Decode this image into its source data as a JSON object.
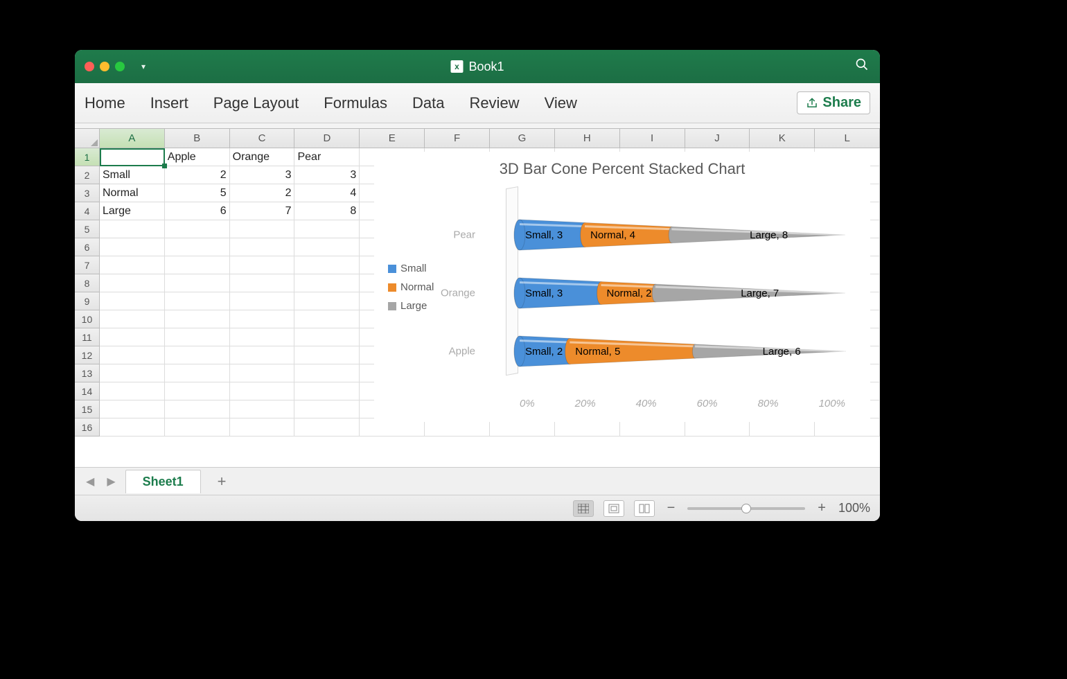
{
  "window": {
    "title": "Book1"
  },
  "ribbon": {
    "tabs": [
      "Home",
      "Insert",
      "Page Layout",
      "Formulas",
      "Data",
      "Review",
      "View"
    ],
    "share": "Share"
  },
  "columns": [
    "A",
    "B",
    "C",
    "D",
    "E",
    "F",
    "G",
    "H",
    "I",
    "J",
    "K",
    "L"
  ],
  "selected_col": "A",
  "selected_row": "1",
  "rows": {
    "headers": [
      "",
      "Apple",
      "Orange",
      "Pear"
    ],
    "data": [
      {
        "label": "Small",
        "cells": [
          "2",
          "3",
          "3"
        ]
      },
      {
        "label": "Normal",
        "cells": [
          "5",
          "2",
          "4"
        ]
      },
      {
        "label": "Large",
        "cells": [
          "6",
          "7",
          "8"
        ]
      }
    ],
    "row_numbers": [
      "1",
      "2",
      "3",
      "4",
      "5",
      "6",
      "7",
      "8",
      "9",
      "10",
      "11",
      "12",
      "13",
      "14",
      "15",
      "16"
    ]
  },
  "chart": {
    "title": "3D Bar Cone Percent Stacked Chart",
    "legend": [
      {
        "name": "Small",
        "color": "#4a90d9"
      },
      {
        "name": "Normal",
        "color": "#ed8b2b"
      },
      {
        "name": "Large",
        "color": "#a6a6a6"
      }
    ],
    "x_ticks": [
      "0%",
      "20%",
      "40%",
      "60%",
      "80%",
      "100%"
    ],
    "bars": [
      {
        "category": "Pear",
        "y": 48,
        "segments": [
          {
            "name": "Small",
            "value": 3,
            "pct": 20.0,
            "color": "#4a90d9"
          },
          {
            "name": "Normal",
            "value": 4,
            "pct": 26.67,
            "color": "#ed8b2b"
          },
          {
            "name": "Large",
            "value": 8,
            "pct": 53.33,
            "color": "#a6a6a6"
          }
        ]
      },
      {
        "category": "Orange",
        "y": 132,
        "segments": [
          {
            "name": "Small",
            "value": 3,
            "pct": 25.0,
            "color": "#4a90d9"
          },
          {
            "name": "Normal",
            "value": 2,
            "pct": 16.67,
            "color": "#ed8b2b"
          },
          {
            "name": "Large",
            "value": 7,
            "pct": 58.33,
            "color": "#a6a6a6"
          }
        ]
      },
      {
        "category": "Apple",
        "y": 216,
        "segments": [
          {
            "name": "Small",
            "value": 2,
            "pct": 15.38,
            "color": "#4a90d9"
          },
          {
            "name": "Normal",
            "value": 5,
            "pct": 38.46,
            "color": "#ed8b2b"
          },
          {
            "name": "Large",
            "value": 6,
            "pct": 46.15,
            "color": "#a6a6a6"
          }
        ]
      }
    ]
  },
  "sheet_tabs": {
    "active": "Sheet1"
  },
  "statusbar": {
    "zoom": "100%"
  },
  "chart_data": {
    "type": "bar",
    "title": "3D Bar Cone Percent Stacked Chart",
    "stacking": "percent",
    "orientation": "horizontal",
    "categories": [
      "Apple",
      "Orange",
      "Pear"
    ],
    "series": [
      {
        "name": "Small",
        "values": [
          2,
          3,
          3
        ]
      },
      {
        "name": "Normal",
        "values": [
          5,
          2,
          4
        ]
      },
      {
        "name": "Large",
        "values": [
          6,
          7,
          8
        ]
      }
    ],
    "xlabel": "",
    "ylabel": "",
    "xlim": [
      0,
      100
    ],
    "x_ticks": [
      "0%",
      "20%",
      "40%",
      "60%",
      "80%",
      "100%"
    ],
    "colors": {
      "Small": "#4a90d9",
      "Normal": "#ed8b2b",
      "Large": "#a6a6a6"
    },
    "data_labels": true,
    "legend_position": "left"
  }
}
